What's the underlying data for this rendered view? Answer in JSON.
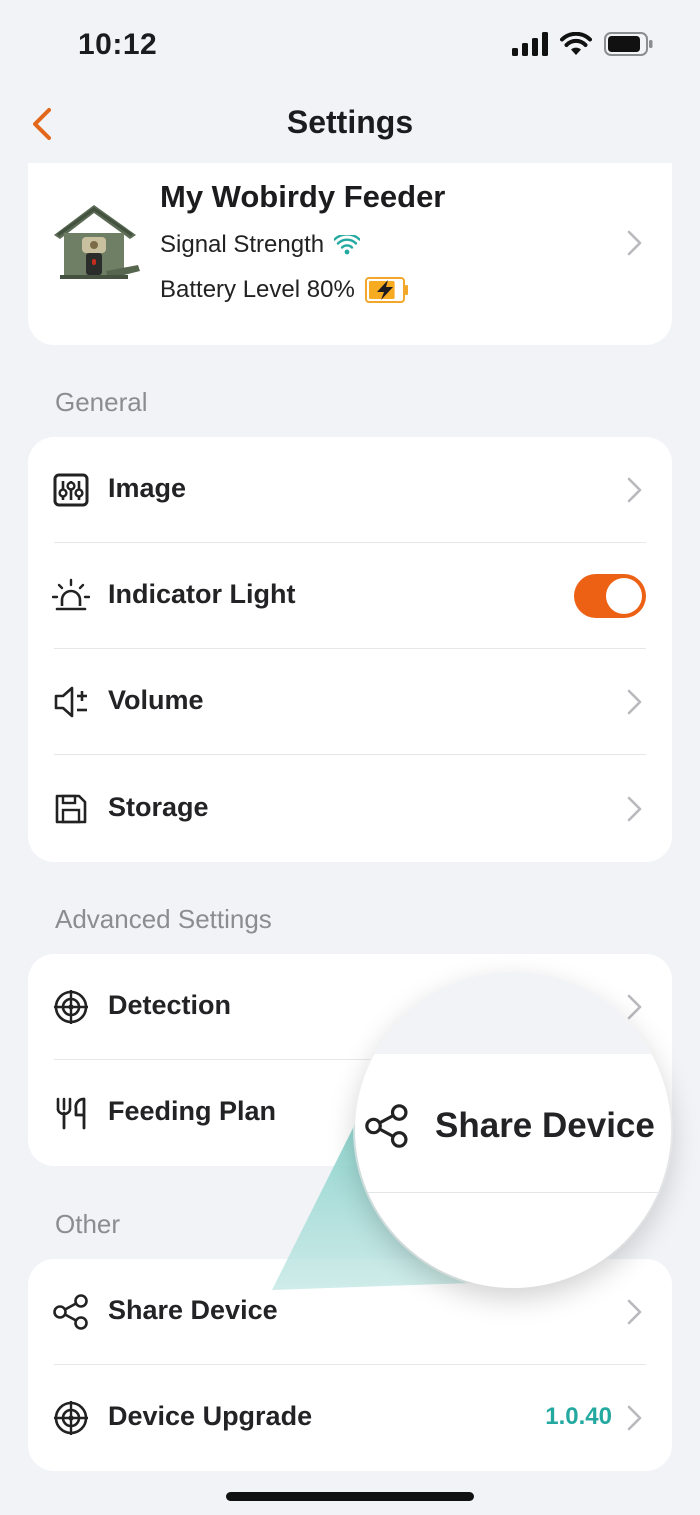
{
  "status_bar": {
    "time": "10:12"
  },
  "header": {
    "title": "Settings"
  },
  "device": {
    "name": "My Wobirdy Feeder",
    "signal_label": "Signal Strength",
    "battery_label": "Battery Level 80%",
    "battery_level": 0.8
  },
  "general": {
    "label": "General",
    "items": [
      {
        "label": "Image",
        "icon": "image-adjust-icon"
      },
      {
        "label": "Indicator Light",
        "icon": "light-icon",
        "toggle": true
      },
      {
        "label": "Volume",
        "icon": "volume-icon"
      },
      {
        "label": "Storage",
        "icon": "storage-icon"
      }
    ]
  },
  "advanced": {
    "label": "Advanced Settings",
    "items": [
      {
        "label": "Detection",
        "icon": "target-icon"
      },
      {
        "label": "Feeding Plan",
        "icon": "fork-knife-icon"
      }
    ]
  },
  "other": {
    "label": "Other",
    "items": [
      {
        "label": "Share Device",
        "icon": "share-icon"
      },
      {
        "label": "Device Upgrade",
        "icon": "target-icon",
        "value": "1.0.40"
      }
    ]
  },
  "callout": {
    "label": "Share Device",
    "icon": "share-icon"
  },
  "colors": {
    "accent": "#ec6114",
    "teal": "#23a9a0",
    "background": "#f1f3f7"
  }
}
